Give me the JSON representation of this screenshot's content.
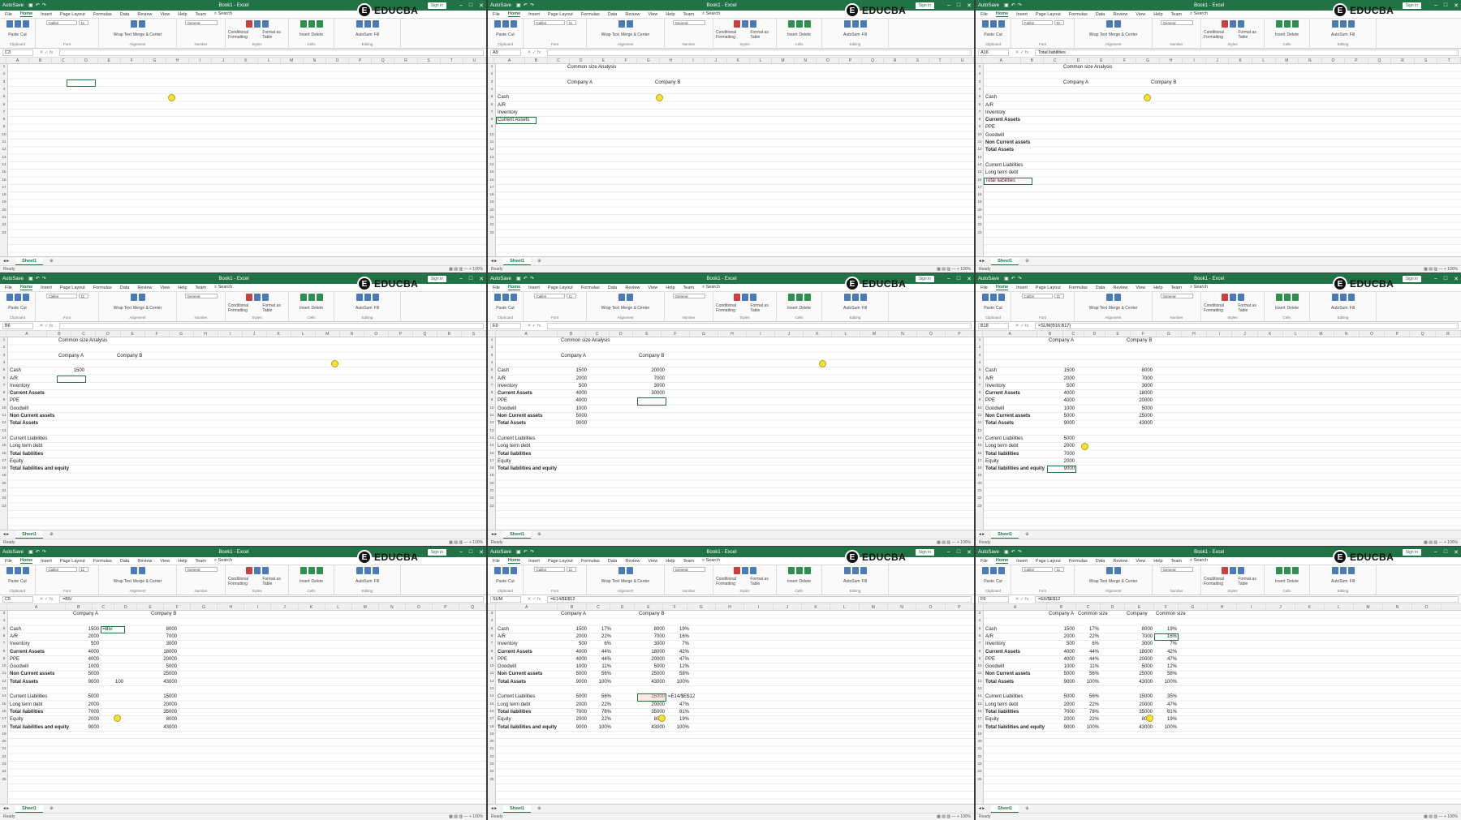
{
  "title_bar": {
    "autosave": "AutoSave",
    "doc_title": "Book1 - Excel",
    "sign_in": "Sign in",
    "search": "Search",
    "logo_text": "EDUCBA",
    "logo_mark": "E"
  },
  "menu": [
    "File",
    "Home",
    "Insert",
    "Page Layout",
    "Formulas",
    "Data",
    "Review",
    "View",
    "Help",
    "Team"
  ],
  "ribbon": {
    "clipboard": [
      "Paste",
      "Cut",
      "Copy",
      "Format Painter",
      "Clipboard"
    ],
    "font": [
      "Calibri",
      "11",
      "Font"
    ],
    "alignment": [
      "Wrap Text",
      "Merge & Center",
      "Alignment"
    ],
    "number": [
      "General",
      "Number"
    ],
    "styles": [
      "Conditional Formatting",
      "Format as Table",
      "Cell Styles",
      "Styles"
    ],
    "cells": [
      "Insert",
      "Delete",
      "Format",
      "Cells"
    ],
    "editing": [
      "AutoSum",
      "Fill",
      "Clear",
      "Sort & Filter",
      "Find & Select",
      "Editing"
    ]
  },
  "sheet_tab": "Sheet1",
  "status_ready": "Ready",
  "zoom": "100%",
  "colors": {
    "excel_green": "#217346",
    "cursor_yellow": "#f4e23a",
    "selection_red": "#f2c4c4"
  },
  "panes": [
    {
      "name_box": "C3",
      "formula": "",
      "cols": [
        "A",
        "B",
        "C",
        "D",
        "E",
        "F",
        "G",
        "H",
        "I",
        "J",
        "K",
        "L",
        "M",
        "N",
        "O",
        "P",
        "Q",
        "R",
        "S",
        "T",
        "U"
      ],
      "cells": []
    },
    {
      "name_box": "A9",
      "formula": "",
      "cols": [
        "A",
        "B",
        "C",
        "D",
        "E",
        "F",
        "G",
        "H",
        "I",
        "J",
        "K",
        "L",
        "M",
        "N",
        "O",
        "P",
        "Q",
        "R",
        "S",
        "T",
        "U"
      ],
      "cells": [
        {
          "t": "Common size Analysis"
        },
        {
          "t": "Company A"
        },
        {
          "t": "Company B"
        },
        {
          "t": "Cash"
        },
        {
          "t": "A/R"
        },
        {
          "t": "Inventory"
        },
        {
          "t": "Current Assets"
        }
      ]
    },
    {
      "name_box": "A16",
      "formula": "Total liabilities",
      "cols": [
        "A",
        "B",
        "C",
        "D",
        "E",
        "F",
        "G",
        "H",
        "I",
        "J",
        "K",
        "L",
        "M",
        "N",
        "O",
        "P",
        "Q",
        "R",
        "S",
        "T"
      ],
      "cells": [
        {
          "t": "Common size Analysis"
        },
        {
          "t": "Company A"
        },
        {
          "t": "Company B"
        },
        {
          "t": "Cash"
        },
        {
          "t": "A/R"
        },
        {
          "t": "Inventory"
        },
        {
          "t": "Current Assets"
        },
        {
          "t": "PPE"
        },
        {
          "t": "Goodwill"
        },
        {
          "t": "Non Current assets"
        },
        {
          "t": "Total Assets"
        },
        {
          "t": "Current Liabilities"
        },
        {
          "t": "Long term debt"
        },
        {
          "t": "Total liabilities"
        }
      ]
    },
    {
      "name_box": "B6",
      "formula": "",
      "cols": [
        "A",
        "B",
        "C",
        "D",
        "E",
        "F",
        "G",
        "H",
        "I",
        "J",
        "K",
        "L",
        "M",
        "N",
        "O",
        "P",
        "Q",
        "R",
        "S"
      ],
      "cells": [
        {
          "t": "Common size Analysis"
        },
        {
          "t": "Company A"
        },
        {
          "t": "Company B"
        },
        {
          "t": "Cash"
        },
        {
          "t": "1500"
        },
        {
          "t": "A/R"
        },
        {
          "t": "Inventory"
        },
        {
          "t": "Current Assets"
        },
        {
          "t": "PPE"
        },
        {
          "t": "Goodwill"
        },
        {
          "t": "Non Current assets"
        },
        {
          "t": "Total Assets"
        },
        {
          "t": "Current Liabilities"
        },
        {
          "t": "Long term debt"
        },
        {
          "t": "Total liabilities"
        },
        {
          "t": "Equity"
        },
        {
          "t": "Total liabilities and equity"
        }
      ]
    },
    {
      "name_box": "E9",
      "formula": "",
      "cols": [
        "A",
        "B",
        "C",
        "D",
        "E",
        "F",
        "G",
        "H",
        "I",
        "J",
        "K",
        "L",
        "M",
        "N",
        "O",
        "P"
      ],
      "cells": [
        {
          "t": "Common size Analysis"
        },
        {
          "t": "Company A"
        },
        {
          "t": "Company B"
        },
        {
          "t": "Cash"
        },
        {
          "t": "1500"
        },
        {
          "t": "20000"
        },
        {
          "t": "A/R"
        },
        {
          "t": "2000"
        },
        {
          "t": "7000"
        },
        {
          "t": "Inventory"
        },
        {
          "t": "500"
        },
        {
          "t": "3000"
        },
        {
          "t": "Current Assets"
        },
        {
          "t": "4000"
        },
        {
          "t": "30000"
        },
        {
          "t": "PPE"
        },
        {
          "t": "4000"
        },
        {
          "t": "Goodwill"
        },
        {
          "t": "1000"
        },
        {
          "t": "Non Current assets"
        },
        {
          "t": "5000"
        },
        {
          "t": "Total Assets"
        },
        {
          "t": "9000"
        },
        {
          "t": "Current Liabilities"
        },
        {
          "t": "Long term debt"
        },
        {
          "t": "Total liabilities"
        },
        {
          "t": "Equity"
        },
        {
          "t": "Total liabilities and equity"
        }
      ]
    },
    {
      "name_box": "B18",
      "formula": "=SUM(B16:B17)",
      "cols": [
        "A",
        "B",
        "C",
        "D",
        "E",
        "F",
        "G",
        "H",
        "I",
        "J",
        "K",
        "L",
        "M",
        "N",
        "O",
        "P",
        "Q",
        "R"
      ],
      "cells": [
        {
          "t": "Company A"
        },
        {
          "t": "Company B"
        },
        {
          "t": "Cash"
        },
        {
          "t": "1500"
        },
        {
          "t": "8000"
        },
        {
          "t": "A/R"
        },
        {
          "t": "2000"
        },
        {
          "t": "7000"
        },
        {
          "t": "Inventory"
        },
        {
          "t": "500"
        },
        {
          "t": "3000"
        },
        {
          "t": "Current Assets"
        },
        {
          "t": "4000"
        },
        {
          "t": "18000"
        },
        {
          "t": "PPE"
        },
        {
          "t": "4000"
        },
        {
          "t": "20000"
        },
        {
          "t": "Goodwill"
        },
        {
          "t": "1000"
        },
        {
          "t": "5000"
        },
        {
          "t": "Non Current assets"
        },
        {
          "t": "5000"
        },
        {
          "t": "25000"
        },
        {
          "t": "Total Assets"
        },
        {
          "t": "9000"
        },
        {
          "t": "43000"
        },
        {
          "t": "Current Liabilities"
        },
        {
          "t": "5000"
        },
        {
          "t": "Long term debt"
        },
        {
          "t": "2000"
        },
        {
          "t": "Total liabilities"
        },
        {
          "t": "7000"
        },
        {
          "t": "Equity"
        },
        {
          "t": "2000"
        },
        {
          "t": "Total liabilities and equity"
        },
        {
          "t": "9000"
        }
      ]
    },
    {
      "name_box": "C5",
      "formula": "=B5/",
      "cols": [
        "A",
        "B",
        "C",
        "D",
        "E",
        "F",
        "G",
        "H",
        "I",
        "J",
        "K",
        "L",
        "M",
        "N",
        "O",
        "P",
        "Q"
      ],
      "cells": [
        {
          "t": "Company A"
        },
        {
          "t": "Company B"
        },
        {
          "t": "Cash"
        },
        {
          "t": "1500"
        },
        {
          "t": "=B5/"
        },
        {
          "t": "8000"
        },
        {
          "t": "A/R"
        },
        {
          "t": "2000"
        },
        {
          "t": "7000"
        },
        {
          "t": "Inventory"
        },
        {
          "t": "500"
        },
        {
          "t": "3000"
        },
        {
          "t": "Current Assets"
        },
        {
          "t": "4000"
        },
        {
          "t": "18000"
        },
        {
          "t": "PPE"
        },
        {
          "t": "4000"
        },
        {
          "t": "20000"
        },
        {
          "t": "Goodwill"
        },
        {
          "t": "1000"
        },
        {
          "t": "5000"
        },
        {
          "t": "Non Current assets"
        },
        {
          "t": "5000"
        },
        {
          "t": "25000"
        },
        {
          "t": "Total Assets"
        },
        {
          "t": "9000"
        },
        {
          "t": "100"
        },
        {
          "t": "43000"
        },
        {
          "t": "Current Liabilities"
        },
        {
          "t": "5000"
        },
        {
          "t": "15000"
        },
        {
          "t": "Long term debt"
        },
        {
          "t": "2000"
        },
        {
          "t": "20000"
        },
        {
          "t": "Total liabilities"
        },
        {
          "t": "7000"
        },
        {
          "t": "35000"
        },
        {
          "t": "Equity"
        },
        {
          "t": "2000"
        },
        {
          "t": "8000"
        },
        {
          "t": "Total liabilities and equity"
        },
        {
          "t": "9000"
        },
        {
          "t": "43000"
        }
      ]
    },
    {
      "name_box": "SUM",
      "formula": "=E14/$E$12",
      "cols": [
        "A",
        "B",
        "C",
        "D",
        "E",
        "F",
        "G",
        "H",
        "I",
        "J",
        "K",
        "L",
        "M",
        "N",
        "O",
        "P"
      ],
      "cells": [
        {
          "t": "Company A"
        },
        {
          "t": "Company B"
        },
        {
          "t": "Cash"
        },
        {
          "t": "1500"
        },
        {
          "t": "17%"
        },
        {
          "t": "8000"
        },
        {
          "t": "19%"
        },
        {
          "t": "A/R"
        },
        {
          "t": "2000"
        },
        {
          "t": "22%"
        },
        {
          "t": "7000"
        },
        {
          "t": "16%"
        },
        {
          "t": "Inventory"
        },
        {
          "t": "500"
        },
        {
          "t": "6%"
        },
        {
          "t": "3000"
        },
        {
          "t": "7%"
        },
        {
          "t": "Current Assets"
        },
        {
          "t": "4000"
        },
        {
          "t": "44%"
        },
        {
          "t": "18000"
        },
        {
          "t": "42%"
        },
        {
          "t": "PPE"
        },
        {
          "t": "4000"
        },
        {
          "t": "44%"
        },
        {
          "t": "20000"
        },
        {
          "t": "47%"
        },
        {
          "t": "Goodwill"
        },
        {
          "t": "1000"
        },
        {
          "t": "11%"
        },
        {
          "t": "5000"
        },
        {
          "t": "12%"
        },
        {
          "t": "Non Current assets"
        },
        {
          "t": "5000"
        },
        {
          "t": "56%"
        },
        {
          "t": "25000"
        },
        {
          "t": "58%"
        },
        {
          "t": "Total Assets"
        },
        {
          "t": "9000"
        },
        {
          "t": "100%"
        },
        {
          "t": "43000"
        },
        {
          "t": "100%"
        },
        {
          "t": "Current Liabilities"
        },
        {
          "t": "5000"
        },
        {
          "t": "56%"
        },
        {
          "t": "15000"
        },
        {
          "t": "=E14/$E$12"
        },
        {
          "t": "Long term debt"
        },
        {
          "t": "2000"
        },
        {
          "t": "22%"
        },
        {
          "t": "20000"
        },
        {
          "t": "47%"
        },
        {
          "t": "Total liabilities"
        },
        {
          "t": "7000"
        },
        {
          "t": "78%"
        },
        {
          "t": "35000"
        },
        {
          "t": "81%"
        },
        {
          "t": "Equity"
        },
        {
          "t": "2000"
        },
        {
          "t": "22%"
        },
        {
          "t": "8000"
        },
        {
          "t": "19%"
        },
        {
          "t": "Total liabilities and equity"
        },
        {
          "t": "9000"
        },
        {
          "t": "100%"
        },
        {
          "t": "43000"
        },
        {
          "t": "100%"
        }
      ]
    },
    {
      "name_box": "F6",
      "formula": "=E6/$E$12",
      "cols": [
        "A",
        "B",
        "C",
        "D",
        "E",
        "F",
        "G",
        "H",
        "I",
        "J",
        "K",
        "L",
        "M",
        "N",
        "O"
      ],
      "cells": [
        {
          "t": "Common size Analysis"
        },
        {
          "t": "Company A"
        },
        {
          "t": "Common size"
        },
        {
          "t": "Company"
        },
        {
          "t": "Common size"
        },
        {
          "t": "Cash"
        },
        {
          "t": "1500"
        },
        {
          "t": "17%"
        },
        {
          "t": "8000"
        },
        {
          "t": "19%"
        },
        {
          "t": "A/R"
        },
        {
          "t": "2000"
        },
        {
          "t": "22%"
        },
        {
          "t": "7000"
        },
        {
          "t": "16%"
        },
        {
          "t": "Inventory"
        },
        {
          "t": "500"
        },
        {
          "t": "6%"
        },
        {
          "t": "3000"
        },
        {
          "t": "7%"
        },
        {
          "t": "Current Assets"
        },
        {
          "t": "4000"
        },
        {
          "t": "44%"
        },
        {
          "t": "18000"
        },
        {
          "t": "42%"
        },
        {
          "t": "PPE"
        },
        {
          "t": "4000"
        },
        {
          "t": "44%"
        },
        {
          "t": "20000"
        },
        {
          "t": "47%"
        },
        {
          "t": "Goodwill"
        },
        {
          "t": "1000"
        },
        {
          "t": "11%"
        },
        {
          "t": "5000"
        },
        {
          "t": "12%"
        },
        {
          "t": "Non Current assets"
        },
        {
          "t": "5000"
        },
        {
          "t": "56%"
        },
        {
          "t": "25000"
        },
        {
          "t": "58%"
        },
        {
          "t": "Total Assets"
        },
        {
          "t": "9000"
        },
        {
          "t": "100%"
        },
        {
          "t": "43000"
        },
        {
          "t": "100%"
        },
        {
          "t": "Current Liabilities"
        },
        {
          "t": "5000"
        },
        {
          "t": "56%"
        },
        {
          "t": "15000"
        },
        {
          "t": "35%"
        },
        {
          "t": "Long term debt"
        },
        {
          "t": "2000"
        },
        {
          "t": "22%"
        },
        {
          "t": "20000"
        },
        {
          "t": "47%"
        },
        {
          "t": "Total liabilities"
        },
        {
          "t": "7000"
        },
        {
          "t": "78%"
        },
        {
          "t": "35000"
        },
        {
          "t": "81%"
        },
        {
          "t": "Equity"
        },
        {
          "t": "2000"
        },
        {
          "t": "22%"
        },
        {
          "t": "8000"
        },
        {
          "t": "19%"
        },
        {
          "t": "Total liabilities and equity"
        },
        {
          "t": "9000"
        },
        {
          "t": "100%"
        },
        {
          "t": "43000"
        },
        {
          "t": "100%"
        }
      ]
    }
  ]
}
